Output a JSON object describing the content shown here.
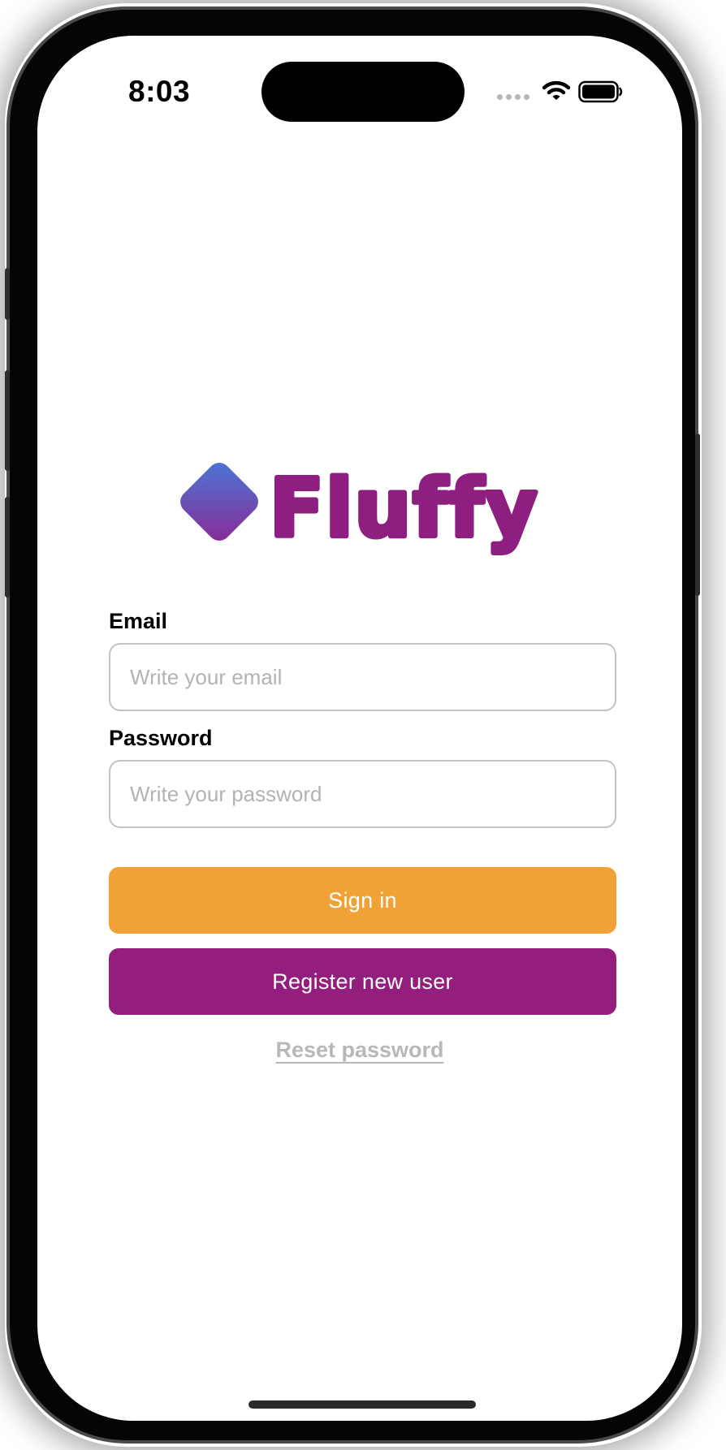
{
  "status_bar": {
    "time": "8:03",
    "icons": [
      "cellular-signal-icon",
      "wifi-icon",
      "battery-icon"
    ]
  },
  "logo": {
    "brand_name": "Fluffy",
    "text_color": "#8e1f80",
    "mark_gradient": [
      "#4a78d6",
      "#8a2a95"
    ]
  },
  "form": {
    "email_label": "Email",
    "email_placeholder": "Write your email",
    "email_value": "",
    "password_label": "Password",
    "password_placeholder": "Write your password",
    "password_value": ""
  },
  "actions": {
    "sign_in_label": "Sign in",
    "register_label": "Register new user",
    "reset_label": "Reset password"
  },
  "colors": {
    "sign_in_bg": "#f0a236",
    "register_bg": "#931e7e",
    "reset_text": "#b8b8b8"
  }
}
